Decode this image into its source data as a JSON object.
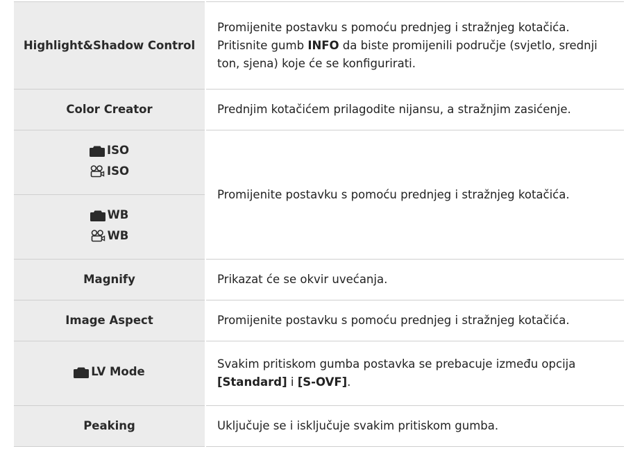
{
  "rows": [
    {
      "label": "Highlight&Shadow Control",
      "desc": {
        "p1": "Promijenite postavku s pomoću prednjeg i stražnjeg kotačića. Pritisnite gumb ",
        "b1": "INFO",
        "p2": " da biste promijenili područje (svjetlo, srednji ton, sjena) koje će se konfigurirati."
      }
    },
    {
      "label": "Color Creator",
      "desc": "Prednjim kotačićem prilagodite nijansu, a stražnjim zasićenje."
    },
    {
      "lines": [
        {
          "icon": "camera-icon",
          "text": "ISO"
        },
        {
          "icon": "movie-camera-icon",
          "text": "ISO"
        }
      ],
      "desc": "Promijenite postavku s pomoću prednjeg i stražnjeg kotačića."
    },
    {
      "lines": [
        {
          "icon": "camera-icon",
          "text": "WB"
        },
        {
          "icon": "movie-camera-icon",
          "text": "WB"
        }
      ]
    },
    {
      "label": "Magnify",
      "desc": "Prikazat će se okvir uvećanja."
    },
    {
      "label": "Image Aspect",
      "desc": "Promijenite postavku s pomoću prednjeg i stražnjeg kotačića."
    },
    {
      "icon": "camera-icon",
      "label": "LV Mode",
      "desc": {
        "p1": "Svakim pritiskom gumba postavka se prebacuje između opcija ",
        "b1": "[Standard]",
        "p2": " i ",
        "b2": "[S-OVF]",
        "p3": "."
      }
    },
    {
      "label": "Peaking",
      "desc": "Uključuje se i isključuje svakim pritiskom gumba."
    }
  ]
}
